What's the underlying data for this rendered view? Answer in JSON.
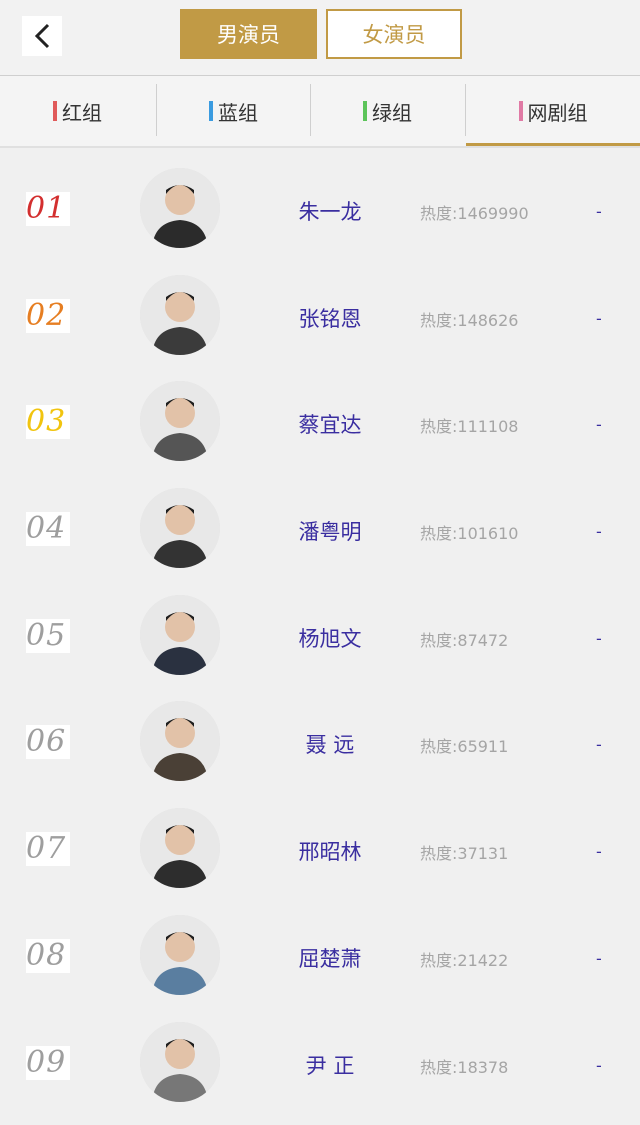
{
  "header": {
    "back_icon": "chevron-left-icon",
    "seg_active": "男演员",
    "seg_inactive": "女演员",
    "accent": "#c19a45"
  },
  "tabs": [
    {
      "label": "红组",
      "color": "#e05a5a"
    },
    {
      "label": "蓝组",
      "color": "#3a9be0"
    },
    {
      "label": "绿组",
      "color": "#5cc45a"
    },
    {
      "label": "网剧组",
      "color": "#e07aa5"
    }
  ],
  "rows": [
    {
      "rank": "01",
      "rank_color": "#d32f2f",
      "name": "朱一龙",
      "heat": "热度:1469990",
      "dash": "-"
    },
    {
      "rank": "02",
      "rank_color": "#e67e22",
      "name": "张铭恩",
      "heat": "热度:148626",
      "dash": "-"
    },
    {
      "rank": "03",
      "rank_color": "#f1c40f",
      "name": "蔡宜达",
      "heat": "热度:111108",
      "dash": "-"
    },
    {
      "rank": "04",
      "rank_color": "#9e9e9e",
      "name": "潘粤明",
      "heat": "热度:101610",
      "dash": "-"
    },
    {
      "rank": "05",
      "rank_color": "#9e9e9e",
      "name": "杨旭文",
      "heat": "热度:87472",
      "dash": "-"
    },
    {
      "rank": "06",
      "rank_color": "#9e9e9e",
      "name": "聂 远",
      "heat": "热度:65911",
      "dash": "-"
    },
    {
      "rank": "07",
      "rank_color": "#9e9e9e",
      "name": "邢昭林",
      "heat": "热度:37131",
      "dash": "-"
    },
    {
      "rank": "08",
      "rank_color": "#9e9e9e",
      "name": "屈楚萧",
      "heat": "热度:21422",
      "dash": "-"
    },
    {
      "rank": "09",
      "rank_color": "#9e9e9e",
      "name": "尹 正",
      "heat": "热度:18378",
      "dash": "-"
    }
  ]
}
